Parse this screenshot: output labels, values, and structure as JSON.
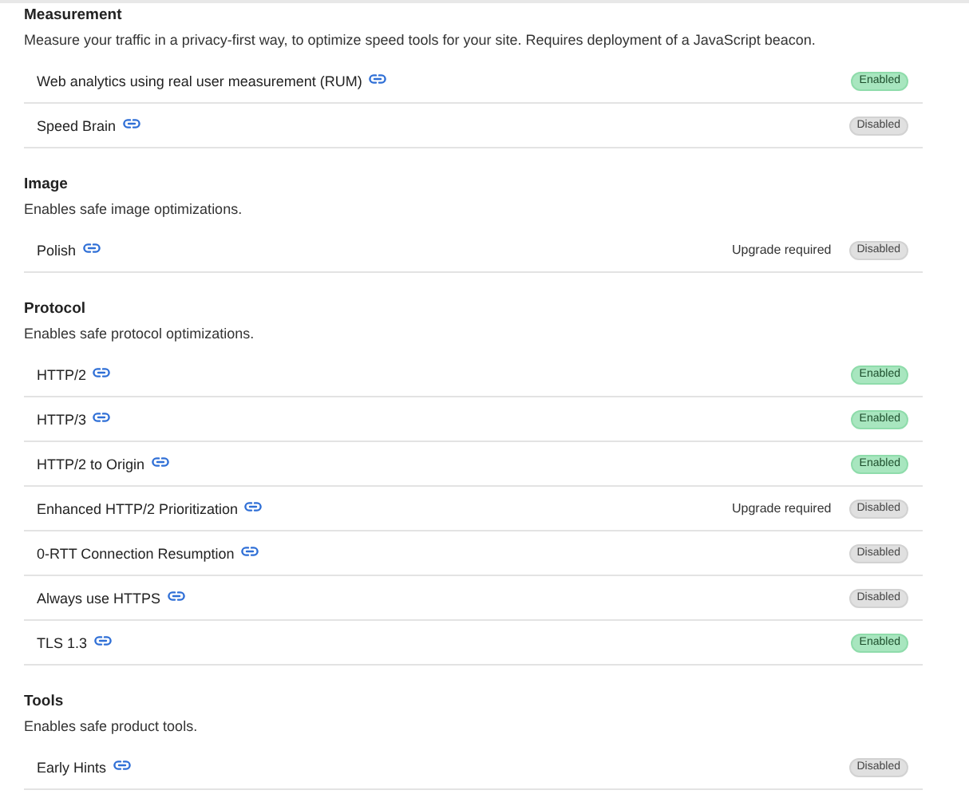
{
  "sections": [
    {
      "title": "Measurement",
      "description": "Measure your traffic in a privacy-first way, to optimize speed tools for your site. Requires deployment of a JavaScript beacon.",
      "settings": [
        {
          "name": "Web analytics using real user measurement (RUM)",
          "status": "Enabled",
          "enabled": true
        },
        {
          "name": "Speed Brain",
          "status": "Disabled",
          "enabled": false
        }
      ]
    },
    {
      "title": "Image",
      "description": "Enables safe image optimizations.",
      "settings": [
        {
          "name": "Polish",
          "note": "Upgrade required",
          "status": "Disabled",
          "enabled": false
        }
      ]
    },
    {
      "title": "Protocol",
      "description": "Enables safe protocol optimizations.",
      "settings": [
        {
          "name": "HTTP/2",
          "status": "Enabled",
          "enabled": true
        },
        {
          "name": "HTTP/3",
          "status": "Enabled",
          "enabled": true
        },
        {
          "name": "HTTP/2 to Origin",
          "status": "Enabled",
          "enabled": true
        },
        {
          "name": "Enhanced HTTP/2 Prioritization",
          "note": "Upgrade required",
          "status": "Disabled",
          "enabled": false
        },
        {
          "name": "0-RTT Connection Resumption",
          "status": "Disabled",
          "enabled": false
        },
        {
          "name": "Always use HTTPS",
          "status": "Disabled",
          "enabled": false
        },
        {
          "name": "TLS 1.3",
          "status": "Enabled",
          "enabled": true
        }
      ]
    },
    {
      "title": "Tools",
      "description": "Enables safe product tools.",
      "settings": [
        {
          "name": "Early Hints",
          "status": "Disabled",
          "enabled": false
        }
      ]
    }
  ]
}
